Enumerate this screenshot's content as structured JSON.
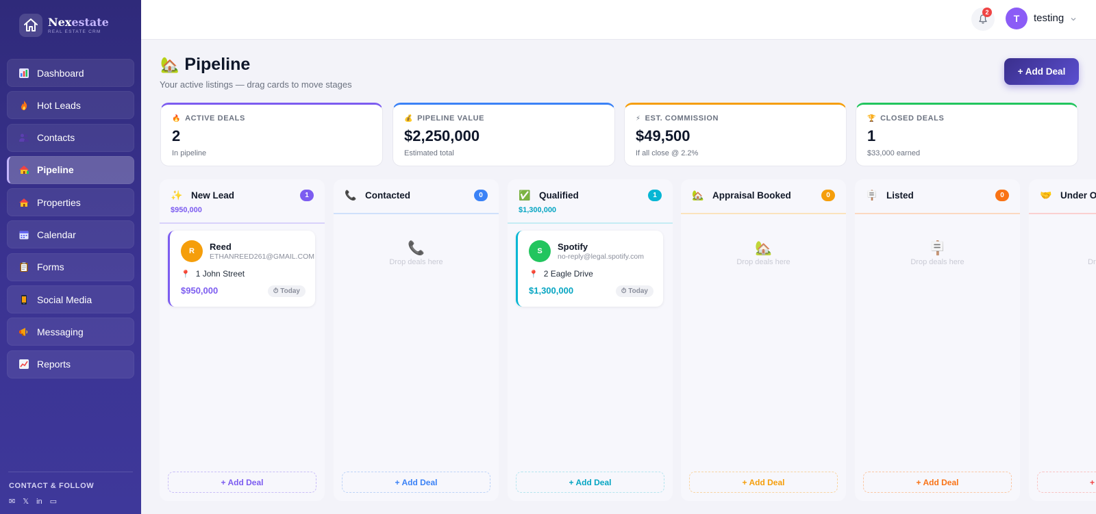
{
  "app": {
    "name_bold": "Nex",
    "name_accent": "estate",
    "tagline": "REAL ESTATE CRM"
  },
  "sidebar": {
    "items": [
      {
        "label": "Dashboard",
        "icon": "bar-chart-icon"
      },
      {
        "label": "Hot Leads",
        "icon": "fire-icon"
      },
      {
        "label": "Contacts",
        "icon": "people-icon"
      },
      {
        "label": "Pipeline",
        "icon": "house-icon",
        "active": true
      },
      {
        "label": "Properties",
        "icon": "house-icon"
      },
      {
        "label": "Calendar",
        "icon": "calendar-icon"
      },
      {
        "label": "Forms",
        "icon": "clipboard-icon"
      },
      {
        "label": "Social Media",
        "icon": "phone-icon"
      },
      {
        "label": "Messaging",
        "icon": "megaphone-icon"
      },
      {
        "label": "Reports",
        "icon": "trend-chart-icon"
      }
    ],
    "contact_title": "CONTACT & FOLLOW",
    "socials": [
      "✉",
      "𝕏",
      "in",
      "▭"
    ]
  },
  "topbar": {
    "notification_count": "2",
    "user_initial": "T",
    "username": "testing"
  },
  "header": {
    "title": "Pipeline",
    "title_icon": "🏡",
    "subtitle": "Your active listings — drag cards to move stages",
    "add_button": "+ Add Deal"
  },
  "stats": [
    {
      "icon": "🔥",
      "label": "ACTIVE DEALS",
      "value": "2",
      "sub": "In pipeline",
      "color": "#7c5cf0"
    },
    {
      "icon": "💰",
      "label": "PIPELINE VALUE",
      "value": "$2,250,000",
      "sub": "Estimated total",
      "color": "#3b82f6"
    },
    {
      "icon": "⚡",
      "label": "EST. COMMISSION",
      "value": "$49,500",
      "sub": "If all close @ 2.2%",
      "color": "#f59e0b"
    },
    {
      "icon": "🏆",
      "label": "CLOSED DEALS",
      "value": "1",
      "sub": "$33,000 earned",
      "color": "#22c55e"
    }
  ],
  "columns": [
    {
      "name": "New Lead",
      "icon": "✨",
      "count": "1",
      "total": "$950,000",
      "color": "#7c5cf0",
      "deal": {
        "initial": "R",
        "name": "Reed",
        "email": "ETHANREED261@GMAIL.COM",
        "address": "1 John Street",
        "amount": "$950,000",
        "date": "⏱ Today",
        "avatar_color": "#f59e0b"
      },
      "add": "+ Add Deal"
    },
    {
      "name": "Contacted",
      "icon": "📞",
      "count": "0",
      "total": "",
      "color": "#3b82f6",
      "drop_icon": "📞",
      "drop_text": "Drop deals here",
      "add": "+ Add Deal"
    },
    {
      "name": "Qualified",
      "icon": "✅",
      "count": "1",
      "total": "$1,300,000",
      "color": "#06b6d4",
      "deal": {
        "initial": "S",
        "name": "Spotify",
        "email": "no-reply@legal.spotify.com",
        "address": "2 Eagle Drive",
        "amount": "$1,300,000",
        "date": "⏱ Today",
        "avatar_color": "#22c55e"
      },
      "add": "+ Add Deal"
    },
    {
      "name": "Appraisal Booked",
      "icon": "🏡",
      "count": "0",
      "total": "",
      "color": "#f59e0b",
      "drop_icon": "🏡",
      "drop_text": "Drop deals here",
      "add": "+ Add Deal"
    },
    {
      "name": "Listed",
      "icon": "🪧",
      "count": "0",
      "total": "",
      "color": "#f97316",
      "drop_icon": "🪧",
      "drop_text": "Drop deals here",
      "add": "+ Add Deal"
    },
    {
      "name": "Under Of",
      "icon": "🤝",
      "count": "",
      "total": "",
      "color": "#ef4444",
      "drop_icon": "",
      "drop_text": "Dro",
      "add": "+"
    }
  ]
}
